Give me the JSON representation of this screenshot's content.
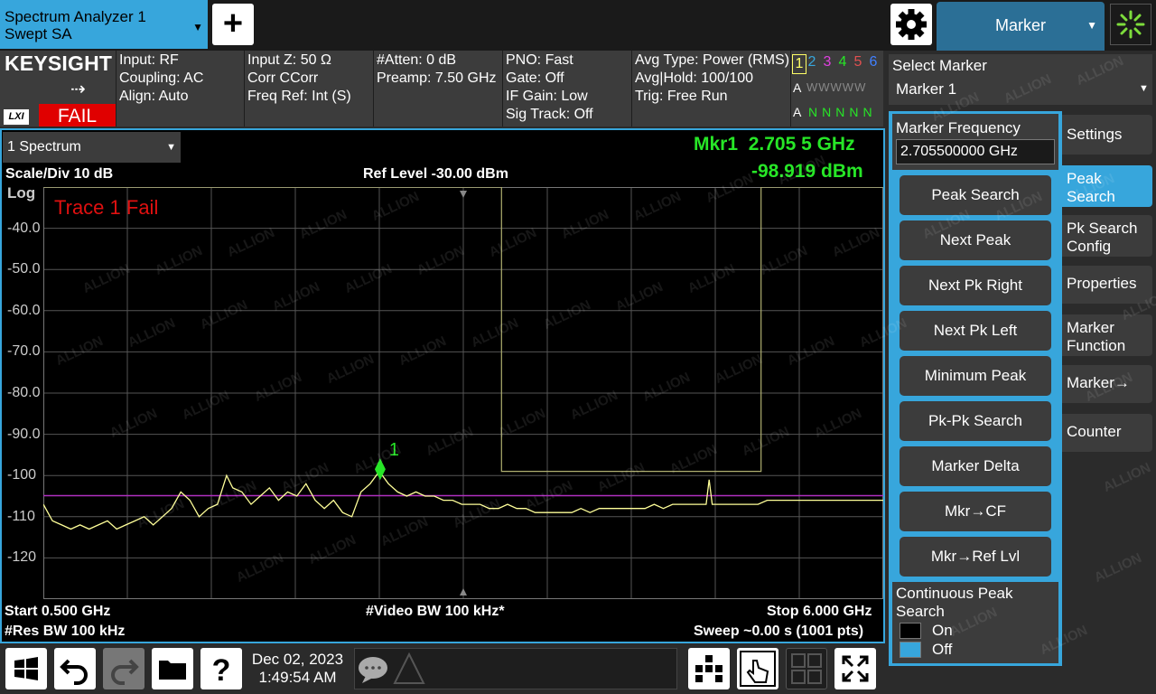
{
  "app": {
    "window_tab_line1": "Spectrum Analyzer 1",
    "window_tab_line2": "Swept SA",
    "add_icon": "plus-icon",
    "settings_icon": "gear-icon",
    "marker_menu_label": "Marker",
    "busy_icon": "busy-spinner-icon"
  },
  "branding": {
    "logo": "KEYSIGHT",
    "lxi": "LXI",
    "status": "FAIL"
  },
  "info": {
    "col1": [
      "Input: RF",
      "Coupling: AC",
      "Align: Auto"
    ],
    "col2": [
      "Input Z: 50 Ω",
      "Corr CCorr",
      "Freq Ref: Int (S)"
    ],
    "col3": [
      "#Atten: 0 dB",
      "Preamp: 7.50 GHz"
    ],
    "col4": [
      "PNO: Fast",
      "Gate: Off",
      "IF Gain: Low",
      "Sig Track: Off"
    ],
    "col5": [
      "Avg Type: Power (RMS)",
      "Avg|Hold: 100/100",
      "Trig: Free Run"
    ],
    "trace_numbers": [
      "1",
      "2",
      "3",
      "4",
      "5",
      "6"
    ],
    "trace_colors": [
      "#ffff66",
      "#37a6dc",
      "#e040e0",
      "#27e627",
      "#e05050",
      "#4080ff"
    ],
    "trace_row1_prefix": "A",
    "trace_row1": "WWWWW",
    "trace_row2_prefix": "A",
    "trace_row2": "NNNNN"
  },
  "display": {
    "window_select": "1 Spectrum",
    "marker_freq": "Mkr1  2.705 5 GHz",
    "marker_amp": "-98.919 dBm",
    "scale": "Scale/Div 10 dB",
    "ref_level": "Ref Level -30.00 dBm",
    "log": "Log",
    "trace_fail": "Trace 1 Fail",
    "marker_label": "1",
    "start": "Start 0.500 GHz",
    "vbw": "#Video BW 100 kHz*",
    "stop": "Stop 6.000 GHz",
    "rbw": "#Res BW 100 kHz",
    "sweep": "Sweep ~0.00 s (1001 pts)",
    "y_ticks": [
      "-40.0",
      "-50.0",
      "-60.0",
      "-70.0",
      "-80.0",
      "-90.0",
      "-100",
      "-110",
      "-120"
    ],
    "watermark": "ALLION",
    "trace_color": "#ffff99",
    "display_line_color": "#b030c0",
    "limit_line_color": "#b0b070",
    "marker_color": "#27e627"
  },
  "trace": {
    "x_start_ghz": 0.5,
    "x_stop_ghz": 6.0,
    "y_top_dbm": -30,
    "y_bottom_dbm": -130,
    "display_line_dbm": -104.9,
    "marker": {
      "x_ghz": 2.7055,
      "y_dbm": -98.919
    },
    "limit_line": [
      [
        0.5,
        -30
      ],
      [
        3.5,
        -30
      ],
      [
        3.5,
        -99
      ],
      [
        5.2,
        -99
      ],
      [
        5.2,
        -30
      ],
      [
        6.0,
        -30
      ]
    ],
    "points_ghz_dbm": [
      [
        0.5,
        -107
      ],
      [
        0.56,
        -111
      ],
      [
        0.62,
        -112
      ],
      [
        0.68,
        -113
      ],
      [
        0.74,
        -112
      ],
      [
        0.8,
        -113
      ],
      [
        0.86,
        -112
      ],
      [
        0.92,
        -111
      ],
      [
        0.98,
        -113
      ],
      [
        1.04,
        -112
      ],
      [
        1.1,
        -111
      ],
      [
        1.16,
        -110
      ],
      [
        1.22,
        -112
      ],
      [
        1.28,
        -110
      ],
      [
        1.34,
        -108
      ],
      [
        1.4,
        -104
      ],
      [
        1.46,
        -106
      ],
      [
        1.52,
        -110
      ],
      [
        1.58,
        -108
      ],
      [
        1.64,
        -107
      ],
      [
        1.7,
        -100
      ],
      [
        1.74,
        -103
      ],
      [
        1.8,
        -104
      ],
      [
        1.86,
        -107
      ],
      [
        1.92,
        -105
      ],
      [
        1.98,
        -103
      ],
      [
        2.04,
        -106
      ],
      [
        2.1,
        -104
      ],
      [
        2.16,
        -105
      ],
      [
        2.22,
        -102
      ],
      [
        2.28,
        -106
      ],
      [
        2.34,
        -108
      ],
      [
        2.4,
        -106
      ],
      [
        2.46,
        -109
      ],
      [
        2.52,
        -110
      ],
      [
        2.58,
        -104
      ],
      [
        2.64,
        -102
      ],
      [
        2.7,
        -99
      ],
      [
        2.76,
        -102
      ],
      [
        2.82,
        -104
      ],
      [
        2.88,
        -105
      ],
      [
        2.94,
        -104
      ],
      [
        3.0,
        -105
      ],
      [
        3.06,
        -105
      ],
      [
        3.12,
        -106
      ],
      [
        3.18,
        -106
      ],
      [
        3.24,
        -107
      ],
      [
        3.3,
        -107
      ],
      [
        3.36,
        -107
      ],
      [
        3.42,
        -108
      ],
      [
        3.48,
        -108
      ],
      [
        3.54,
        -107
      ],
      [
        3.6,
        -108
      ],
      [
        3.66,
        -108
      ],
      [
        3.72,
        -109
      ],
      [
        3.78,
        -109
      ],
      [
        3.84,
        -109
      ],
      [
        3.9,
        -109
      ],
      [
        3.96,
        -109
      ],
      [
        4.02,
        -108
      ],
      [
        4.08,
        -109
      ],
      [
        4.14,
        -108
      ],
      [
        4.2,
        -108
      ],
      [
        4.26,
        -108
      ],
      [
        4.32,
        -108
      ],
      [
        4.38,
        -108
      ],
      [
        4.44,
        -108
      ],
      [
        4.5,
        -107
      ],
      [
        4.56,
        -108
      ],
      [
        4.62,
        -107
      ],
      [
        4.68,
        -107
      ],
      [
        4.74,
        -107
      ],
      [
        4.8,
        -107
      ],
      [
        4.84,
        -107
      ],
      [
        4.86,
        -101
      ],
      [
        4.88,
        -107
      ],
      [
        4.94,
        -107
      ],
      [
        5.0,
        -107
      ],
      [
        5.06,
        -107
      ],
      [
        5.12,
        -107
      ],
      [
        5.18,
        -107
      ],
      [
        5.24,
        -106
      ],
      [
        5.3,
        -106
      ],
      [
        5.36,
        -106
      ],
      [
        5.42,
        -106
      ],
      [
        5.48,
        -106
      ],
      [
        5.54,
        -106
      ],
      [
        5.6,
        -106
      ],
      [
        5.66,
        -106
      ],
      [
        5.72,
        -106
      ],
      [
        5.78,
        -106
      ],
      [
        5.84,
        -106
      ],
      [
        5.9,
        -106
      ],
      [
        5.96,
        -106
      ],
      [
        6.0,
        -106
      ]
    ]
  },
  "right": {
    "select_marker_title": "Select Marker",
    "select_marker_value": "Marker 1",
    "mkr_freq_label": "Marker Frequency",
    "mkr_freq_value": "2.705500000 GHz",
    "softkeys": [
      "Peak Search",
      "Next Peak",
      "Next Pk Right",
      "Next Pk Left",
      "Minimum Peak",
      "Pk-Pk Search",
      "Marker Delta",
      "Mkr→CF",
      "Mkr→Ref Lvl"
    ],
    "cont_peak_label": "Continuous Peak Search",
    "cont_on": "On",
    "cont_off": "Off",
    "tabs": [
      "Settings",
      "Peak Search",
      "Pk Search Config",
      "Properties",
      "Marker Function",
      "Marker→",
      "Counter"
    ]
  },
  "bottom": {
    "date": "Dec 02, 2023",
    "time": "1:49:54 AM",
    "icons": [
      "windows-icon",
      "undo-icon",
      "redo-icon",
      "folder-icon",
      "help-icon",
      "message-icon",
      "warning-icon",
      "display-layout-icon",
      "touch-icon",
      "window-grid-icon",
      "maximize-icon"
    ]
  }
}
